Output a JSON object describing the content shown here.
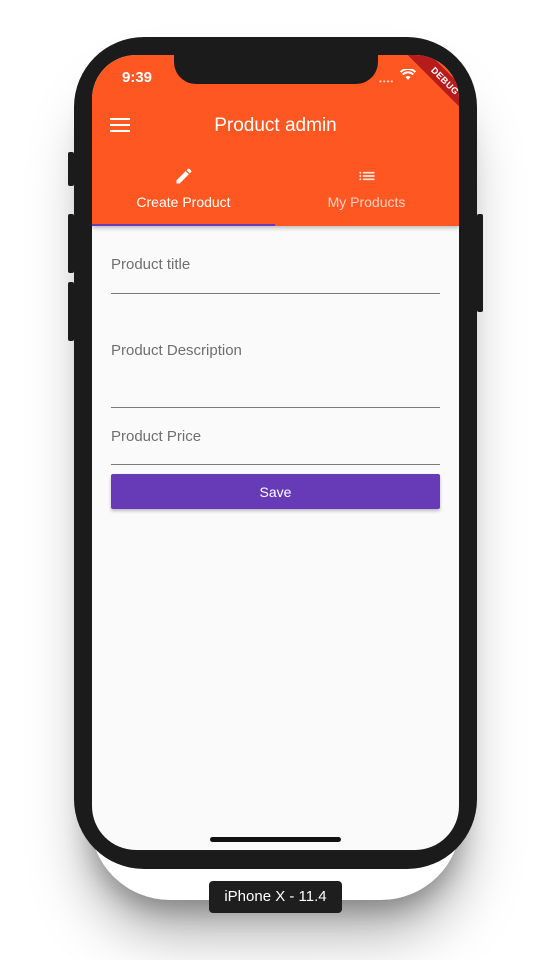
{
  "status_bar": {
    "time": "9:39",
    "debug_banner": "DEBUG"
  },
  "app_bar": {
    "title": "Product admin",
    "menu_icon": "hamburger-menu-icon",
    "color": "#ff5722"
  },
  "tabs": [
    {
      "label": "Create Product",
      "icon": "pencil-icon",
      "selected": true
    },
    {
      "label": "My Products",
      "icon": "list-icon",
      "selected": false
    }
  ],
  "form": {
    "title_label": "Product title",
    "title_value": "",
    "description_label": "Product Description",
    "description_value": "",
    "price_label": "Product Price",
    "price_value": "",
    "save_label": "Save",
    "button_color": "#673ab7"
  },
  "device": {
    "label": "iPhone X - 11.4"
  }
}
